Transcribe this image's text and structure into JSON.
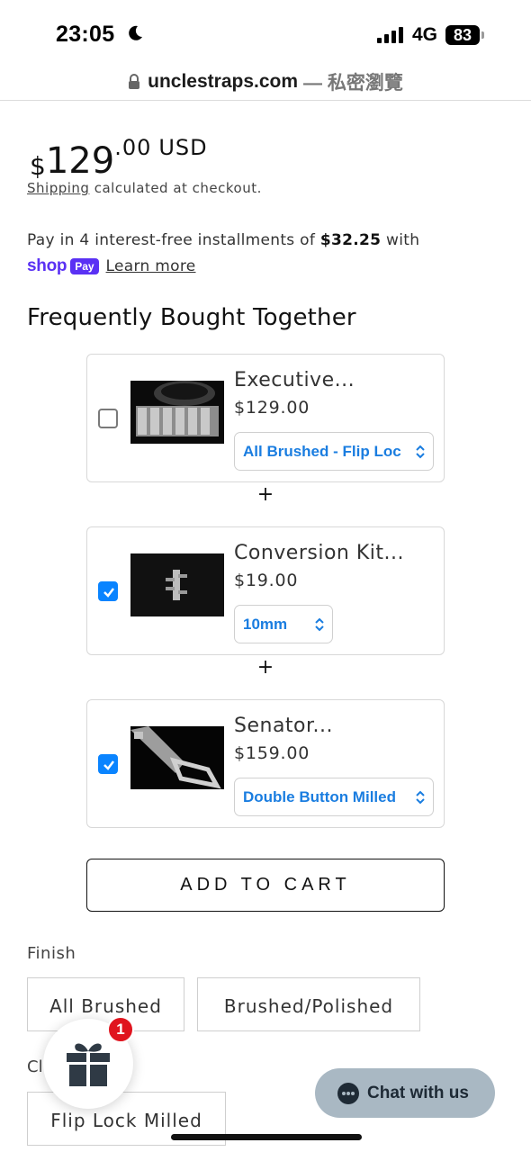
{
  "status_bar": {
    "time": "23:05",
    "network": "4G",
    "battery": "83"
  },
  "browser": {
    "domain": "unclestraps.com",
    "suffix": "— 私密瀏覽"
  },
  "product": {
    "price_currency_symbol": "$",
    "price_major": "129",
    "price_minor": ".00",
    "price_code": "USD",
    "shipping_link": "Shipping",
    "shipping_rest": "calculated at checkout."
  },
  "installments": {
    "text": "Pay in 4 interest-free installments of",
    "amount": "$32.25",
    "tail": "with",
    "shop_text": "shop",
    "pay_badge": "Pay",
    "learn_more": "Learn more"
  },
  "fbt": {
    "heading": "Frequently Bought Together",
    "plus": "+",
    "items": [
      {
        "title": "Executive...",
        "price": "$129.00",
        "option": "All Brushed - Flip Loc",
        "checked": false
      },
      {
        "title": "Conversion Kit...",
        "price": "$19.00",
        "option": "10mm",
        "checked": true
      },
      {
        "title": "Senator...",
        "price": "$159.00",
        "option": "Double Button Milled",
        "checked": true
      }
    ],
    "add_to_cart": "ADD TO CART"
  },
  "finish": {
    "label": "Finish",
    "options": [
      "All Brushed",
      "Brushed/Polished"
    ]
  },
  "clasp": {
    "label_partial": "Cl",
    "options": [
      "Flip Lock Milled"
    ]
  },
  "gift": {
    "badge": "1",
    "icon": "gift-icon"
  },
  "chat": {
    "label": "Chat with us",
    "icon": "chat-bubble-icon"
  },
  "colors": {
    "accent_blue": "#0a84ff",
    "shop_purple": "#5a31f4",
    "badge_red": "#e0141e",
    "chat_bg": "#a9b8c3"
  }
}
